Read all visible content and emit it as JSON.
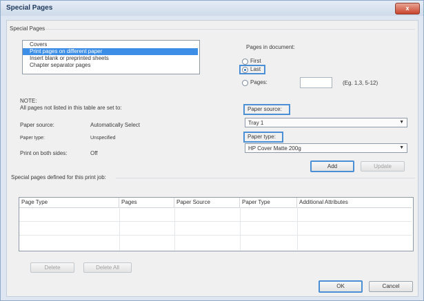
{
  "window": {
    "title": "Special Pages",
    "close_glyph": "x"
  },
  "group": {
    "label": "Special Pages"
  },
  "page_list": {
    "items": [
      {
        "label": "Covers",
        "selected": false
      },
      {
        "label": "Print pages on different paper",
        "selected": true
      },
      {
        "label": "Insert blank or preprinted sheets",
        "selected": false
      },
      {
        "label": "Chapter separator pages",
        "selected": false
      }
    ]
  },
  "pages_in_document": {
    "label": "Pages in document:",
    "options": [
      {
        "label": "First",
        "checked": false
      },
      {
        "label": "Last",
        "checked": true
      },
      {
        "label": "Pages:",
        "checked": false
      }
    ],
    "pages_value": "",
    "pages_hint": "(Eg. 1,3, 5-12)"
  },
  "note": {
    "heading": "NOTE:",
    "text": "All pages not listed in this table are set to:",
    "rows": [
      {
        "label": "Paper source:",
        "value": "Automatically Select"
      },
      {
        "label": "Paper type:",
        "value": "Unspecified"
      },
      {
        "label": "Print on both sides:",
        "value": "Off"
      }
    ]
  },
  "paper_source": {
    "label": "Paper source:",
    "value": "Tray 1"
  },
  "paper_type": {
    "label": "Paper type:",
    "value": "HP Cover Matte 200g"
  },
  "buttons": {
    "add": "Add",
    "update": "Update",
    "delete": "Delete",
    "delete_all": "Delete All",
    "ok": "OK",
    "cancel": "Cancel"
  },
  "defined_table": {
    "label": "Special pages defined for this print job:",
    "columns": [
      "Page Type",
      "Pages",
      "Paper Source",
      "Paper Type",
      "Additional Attributes"
    ]
  },
  "colors": {
    "highlight_border": "#4a8fd6",
    "selection": "#3d8ee6"
  },
  "icons": {
    "dropdown": "chevron-down-icon"
  }
}
